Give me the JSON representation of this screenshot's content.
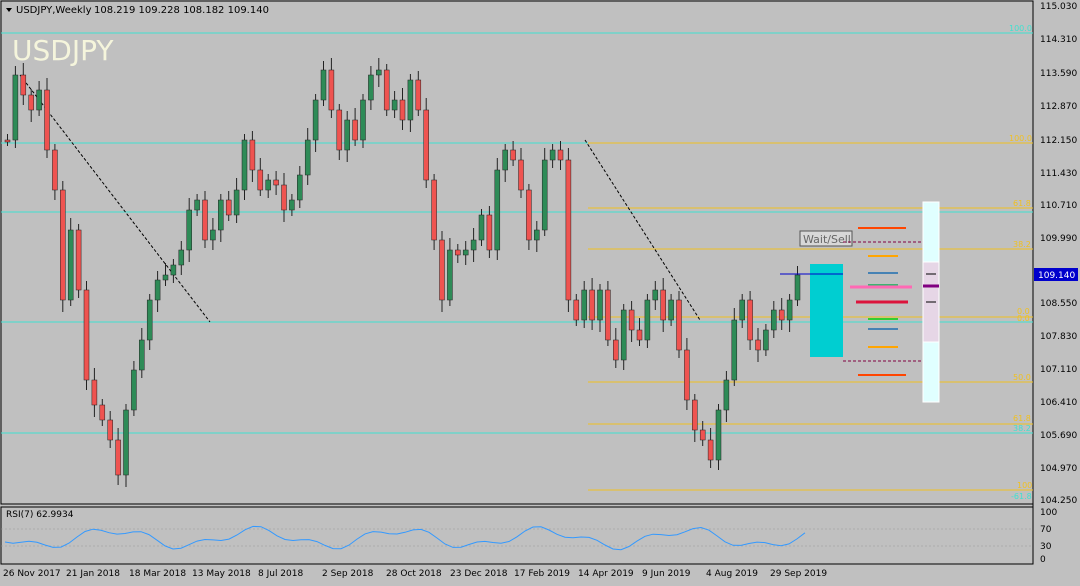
{
  "header": {
    "symbol_line": "USDJPY,Weekly",
    "ohlc": "108.219 109.228 108.182 109.140",
    "watermark": "USDJPY"
  },
  "colors": {
    "background": "#c0c0c0",
    "bull_candle": "#2e8b57",
    "bear_candle": "#ef5350",
    "horizontal_level": "#40e0d0",
    "fib_line": "#f0c020",
    "price_marker_bg": "#0000cc",
    "rsi_line": "#3399ff",
    "zone_fill": "#00ced1"
  },
  "price_axis": {
    "labels": [
      "115.030",
      "114.310",
      "113.590",
      "112.870",
      "112.150",
      "111.430",
      "110.710",
      "109.990",
      "109.270",
      "108.550",
      "107.830",
      "107.110",
      "106.410",
      "105.690",
      "104.970",
      "104.250"
    ],
    "current_price": "109.140"
  },
  "time_axis": {
    "labels": [
      "26 Nov 2017",
      "21 Jan 2018",
      "18 Mar 2018",
      "13 May 2018",
      "8 Jul 2018",
      "2 Sep 2018",
      "28 Oct 2018",
      "23 Dec 2018",
      "17 Feb 2019",
      "14 Apr 2019",
      "9 Jun 2019",
      "4 Aug 2019",
      "29 Sep 2019"
    ]
  },
  "fib_labels": {
    "f100a": "100.0",
    "f100b": "100.0",
    "f618a": "61.8",
    "f382": "38.2",
    "f0": "0.0",
    "f00": "0.0",
    "f500": "50.0",
    "f618b": "61.8",
    "f382b": "38.2",
    "f100c": "100",
    "f618c": "-61.8"
  },
  "annotation": {
    "wait_sell": "Wait/Sell"
  },
  "rsi": {
    "label": "RSI(7) 62.9934",
    "levels": [
      "100",
      "70",
      "30",
      "0"
    ]
  }
}
